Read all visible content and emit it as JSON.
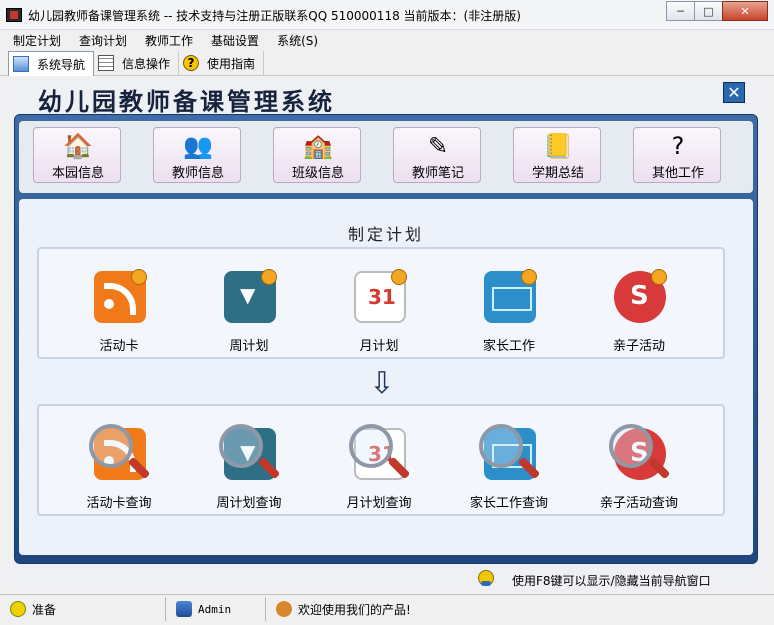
{
  "window": {
    "title": "幼儿园教师备课管理系统 -- 技术支持与注册正版联系QQ 510000118    当前版本：(非注册版)",
    "min_label": "─",
    "max_label": "□",
    "close_label": "✕"
  },
  "menu": {
    "items": [
      "制定计划",
      "查询计划",
      "教师工作",
      "基础设置",
      "系统(S)"
    ]
  },
  "toolbar": {
    "tabs": [
      {
        "label": "系统导航",
        "icon": "navigation-icon",
        "active": true
      },
      {
        "label": "信息操作",
        "icon": "grid-icon",
        "active": false
      },
      {
        "label": "使用指南",
        "icon": "help-icon",
        "active": false
      }
    ]
  },
  "app": {
    "title": "幼儿园教师备课管理系统",
    "close_label": "✕"
  },
  "top_buttons": [
    {
      "label": "本园信息",
      "icon": "house-icon",
      "glyph": "🏠"
    },
    {
      "label": "教师信息",
      "icon": "people-icon",
      "glyph": "👥"
    },
    {
      "label": "班级信息",
      "icon": "building-icon",
      "glyph": "🏫"
    },
    {
      "label": "教师笔记",
      "icon": "notepad-icon",
      "glyph": "✎"
    },
    {
      "label": "学期总结",
      "icon": "book-icon",
      "glyph": "📒"
    },
    {
      "label": "其他工作",
      "icon": "help-document-icon",
      "glyph": "?"
    }
  ],
  "plan_section": {
    "heading": "制定计划",
    "arrow": "⇩",
    "create_items": [
      {
        "label": "活动卡",
        "icon": "rss-card-icon"
      },
      {
        "label": "周计划",
        "icon": "folder-icon"
      },
      {
        "label": "月计划",
        "icon": "calendar-icon"
      },
      {
        "label": "家长工作",
        "icon": "envelope-icon"
      },
      {
        "label": "亲子活动",
        "icon": "heart-icon"
      }
    ],
    "query_items": [
      {
        "label": "活动卡查询",
        "icon": "rss-search-icon"
      },
      {
        "label": "周计划查询",
        "icon": "folder-search-icon"
      },
      {
        "label": "月计划查询",
        "icon": "calendar-search-icon"
      },
      {
        "label": "家长工作查询",
        "icon": "envelope-search-icon"
      },
      {
        "label": "亲子活动查询",
        "icon": "heart-search-icon"
      }
    ]
  },
  "hint": {
    "text": "使用F8键可以显示/隐藏当前导航窗口"
  },
  "status": {
    "ready": "准备",
    "user": "Admin",
    "welcome": "欢迎使用我们的产品!"
  }
}
